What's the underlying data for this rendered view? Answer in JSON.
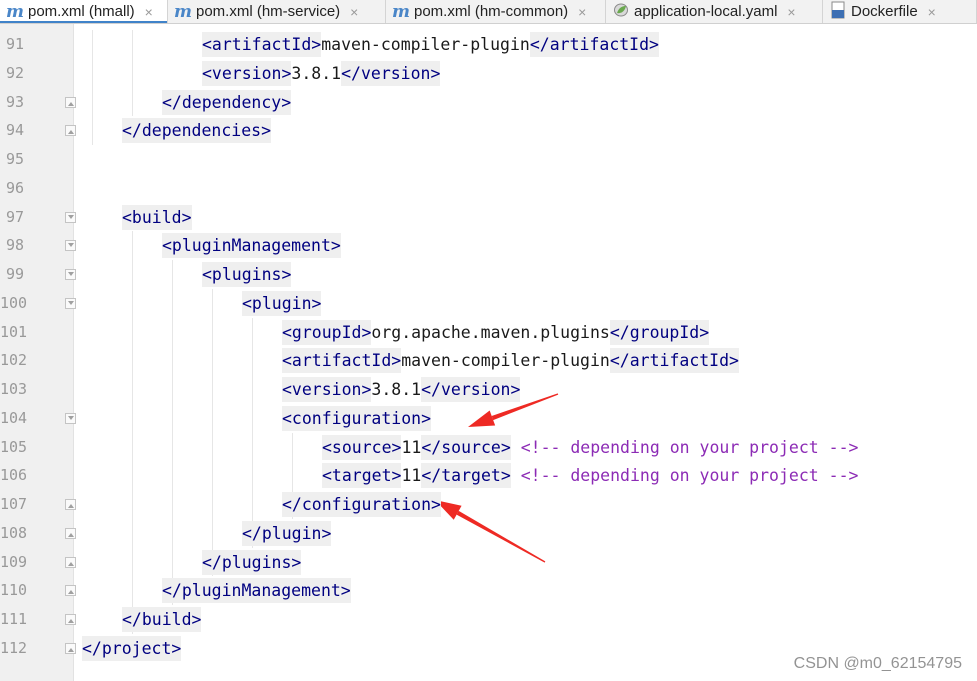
{
  "tabs": [
    {
      "label": "pom.xml (hmall)",
      "icon": "maven-icon",
      "active": true
    },
    {
      "label": "pom.xml (hm-service)",
      "icon": "maven-icon",
      "active": false
    },
    {
      "label": "pom.xml (hm-common)",
      "icon": "maven-icon",
      "active": false
    },
    {
      "label": "application-local.yaml",
      "icon": "spring-leaf-icon",
      "active": false
    },
    {
      "label": "Dockerfile",
      "icon": "docker-file-icon",
      "active": false
    }
  ],
  "tab_close_glyph": "×",
  "maven_glyph": "m",
  "lines": [
    {
      "num": "91",
      "indent": 3,
      "fold": "",
      "tokens": [
        {
          "t": "tag",
          "v": "<artifactId>"
        },
        {
          "t": "txt",
          "v": "maven-compiler-plugin"
        },
        {
          "t": "tag",
          "v": "</artifactId>"
        }
      ]
    },
    {
      "num": "92",
      "indent": 3,
      "fold": "",
      "tokens": [
        {
          "t": "tag",
          "v": "<version>"
        },
        {
          "t": "txt",
          "v": "3.8.1"
        },
        {
          "t": "tag",
          "v": "</version>"
        }
      ]
    },
    {
      "num": "93",
      "indent": 2,
      "fold": "close",
      "tokens": [
        {
          "t": "tag",
          "v": "</dependency>"
        }
      ]
    },
    {
      "num": "94",
      "indent": 1,
      "fold": "close",
      "tokens": [
        {
          "t": "tag",
          "v": "</dependencies>"
        }
      ]
    },
    {
      "num": "95",
      "indent": 0,
      "fold": "",
      "tokens": []
    },
    {
      "num": "96",
      "indent": 0,
      "fold": "",
      "tokens": []
    },
    {
      "num": "97",
      "indent": 1,
      "fold": "open",
      "tokens": [
        {
          "t": "tag",
          "v": "<build>"
        }
      ]
    },
    {
      "num": "98",
      "indent": 2,
      "fold": "open",
      "tokens": [
        {
          "t": "tag",
          "v": "<pluginManagement>"
        }
      ]
    },
    {
      "num": "99",
      "indent": 3,
      "fold": "open",
      "tokens": [
        {
          "t": "tag",
          "v": "<plugins>"
        }
      ]
    },
    {
      "num": "100",
      "indent": 4,
      "fold": "open",
      "tokens": [
        {
          "t": "tag",
          "v": "<plugin>"
        }
      ]
    },
    {
      "num": "101",
      "indent": 5,
      "fold": "",
      "tokens": [
        {
          "t": "tag",
          "v": "<groupId>"
        },
        {
          "t": "txt",
          "v": "org.apache.maven.plugins"
        },
        {
          "t": "tag",
          "v": "</groupId>"
        }
      ]
    },
    {
      "num": "102",
      "indent": 5,
      "fold": "",
      "tokens": [
        {
          "t": "tag",
          "v": "<artifactId>"
        },
        {
          "t": "txt",
          "v": "maven-compiler-plugin"
        },
        {
          "t": "tag",
          "v": "</artifactId>"
        }
      ]
    },
    {
      "num": "103",
      "indent": 5,
      "fold": "",
      "tokens": [
        {
          "t": "tag",
          "v": "<version>"
        },
        {
          "t": "txt",
          "v": "3.8.1"
        },
        {
          "t": "tag",
          "v": "</version>"
        }
      ]
    },
    {
      "num": "104",
      "indent": 5,
      "fold": "open",
      "tokens": [
        {
          "t": "tag",
          "v": "<configuration>"
        }
      ]
    },
    {
      "num": "105",
      "indent": 6,
      "fold": "",
      "tokens": [
        {
          "t": "tag",
          "v": "<source>"
        },
        {
          "t": "txt",
          "v": "11"
        },
        {
          "t": "tag",
          "v": "</source>"
        },
        {
          "t": "txt",
          "v": " "
        },
        {
          "t": "cmt",
          "v": "<!-- depending on your project -->"
        }
      ]
    },
    {
      "num": "106",
      "indent": 6,
      "fold": "",
      "tokens": [
        {
          "t": "tag",
          "v": "<target>"
        },
        {
          "t": "txt",
          "v": "11"
        },
        {
          "t": "tag",
          "v": "</target>"
        },
        {
          "t": "txt",
          "v": " "
        },
        {
          "t": "cmt",
          "v": "<!-- depending on your project -->"
        }
      ]
    },
    {
      "num": "107",
      "indent": 5,
      "fold": "close",
      "tokens": [
        {
          "t": "tag",
          "v": "</configuration>"
        }
      ]
    },
    {
      "num": "108",
      "indent": 4,
      "fold": "close",
      "tokens": [
        {
          "t": "tag",
          "v": "</plugin>"
        }
      ]
    },
    {
      "num": "109",
      "indent": 3,
      "fold": "close",
      "tokens": [
        {
          "t": "tag",
          "v": "</plugins>"
        }
      ]
    },
    {
      "num": "110",
      "indent": 2,
      "fold": "close",
      "tokens": [
        {
          "t": "tag",
          "v": "</pluginManagement>"
        }
      ]
    },
    {
      "num": "111",
      "indent": 1,
      "fold": "close",
      "tokens": [
        {
          "t": "tag",
          "v": "</build>"
        }
      ]
    },
    {
      "num": "112",
      "indent": 0,
      "fold": "close",
      "tokens": [
        {
          "t": "tag",
          "v": "</project>"
        }
      ]
    }
  ],
  "watermark": "CSDN @m0_62154795",
  "colors": {
    "tag_text": "#000080",
    "tag_bg": "#efefef",
    "comment": "#8c2bb5",
    "line_number": "#999999",
    "active_tab_underline": "#4083c9",
    "annotation_arrow": "#ee2a24"
  },
  "annotations": [
    {
      "name": "red-arrow-to-configuration-open",
      "points_to_line": "104"
    },
    {
      "name": "red-arrow-to-configuration-close",
      "points_to_line": "107"
    }
  ]
}
